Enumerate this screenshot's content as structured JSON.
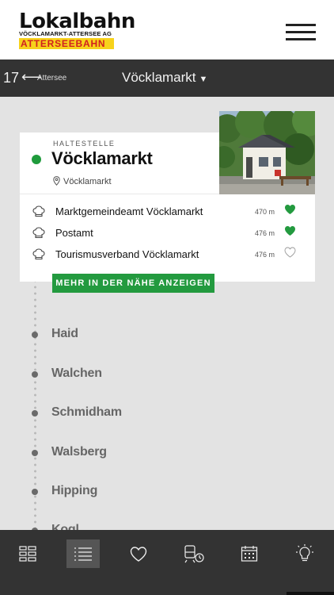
{
  "header": {
    "logo_main": "Lokalbahn",
    "logo_sub": "VÖCKLAMARKT-ATTERSEE AG",
    "logo_band": "ATTERSEEBAHN"
  },
  "subnav": {
    "route_number": "17",
    "route_arrow": "⟵",
    "route_destination": "Attersee",
    "selected_station": "Vöcklamarkt",
    "caret": "▼"
  },
  "stop_card": {
    "label": "HALTESTELLE",
    "name": "Vöcklamarkt",
    "location": "Vöcklamarkt",
    "pois": [
      {
        "name": "Marktgemeindeamt Vöcklamarkt",
        "distance": "470 m",
        "favorite": true
      },
      {
        "name": "Postamt",
        "distance": "476 m",
        "favorite": true
      },
      {
        "name": "Tourismusverband Vöcklamarkt",
        "distance": "476 m",
        "favorite": false
      }
    ],
    "more_button": "MEHR IN DER NÄHE ANZEIGEN"
  },
  "stops": [
    "Haid",
    "Walchen",
    "Schmidham",
    "Walsberg",
    "Hipping",
    "Kogl"
  ],
  "tabbar": {
    "tabs": [
      "grid-icon",
      "list-icon",
      "heart-icon",
      "train-clock-icon",
      "calendar-icon",
      "lightbulb-icon"
    ],
    "active_tab": "list-icon"
  },
  "colors": {
    "accent_green": "#239a3f",
    "header_dark": "#333333",
    "logo_yellow": "#f7d21b",
    "logo_red": "#d11f1f"
  }
}
